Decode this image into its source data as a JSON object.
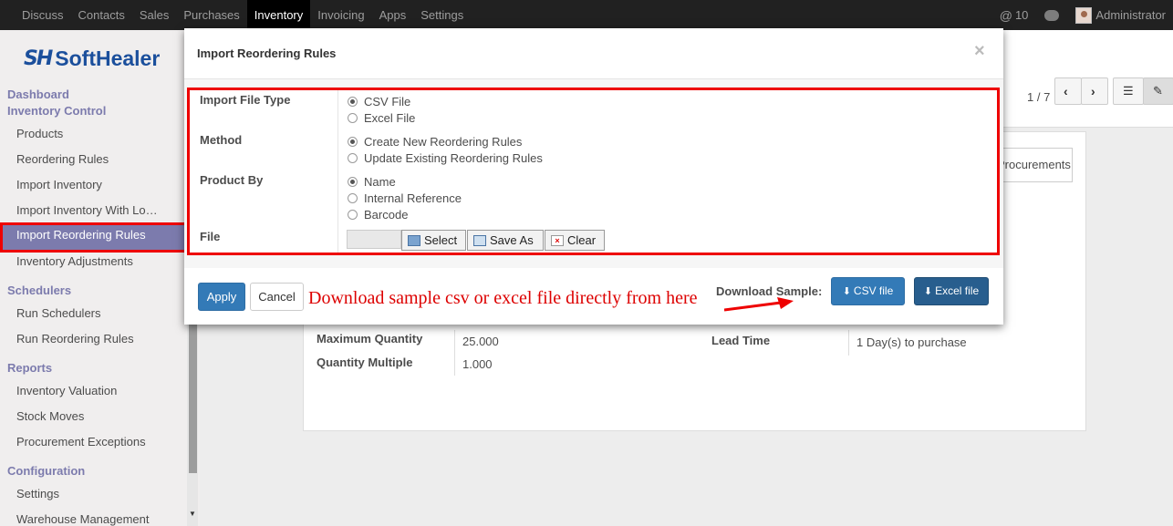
{
  "topnav": {
    "items": [
      "Discuss",
      "Contacts",
      "Sales",
      "Purchases",
      "Inventory",
      "Invoicing",
      "Apps",
      "Settings"
    ],
    "active": "Inventory",
    "message_count": "10",
    "user": "Administrator"
  },
  "logo": {
    "mark": "SH",
    "name": "SoftHealer"
  },
  "sidebar": {
    "dashboard": "Dashboard",
    "inventory_control": "Inventory Control",
    "items_control": [
      "Products",
      "Reordering Rules",
      "Import Inventory",
      "Import Inventory With Lo…",
      "Import Reordering Rules",
      "Inventory Adjustments"
    ],
    "schedulers": "Schedulers",
    "items_schedulers": [
      "Run Schedulers",
      "Run Reordering Rules"
    ],
    "reports": "Reports",
    "items_reports": [
      "Inventory Valuation",
      "Stock Moves",
      "Procurement Exceptions"
    ],
    "configuration": "Configuration",
    "items_configuration": [
      "Settings",
      "Warehouse Management"
    ]
  },
  "background": {
    "pager": "1 / 7",
    "procurements_button": "Procurements",
    "max_qty_label": "Maximum Quantity",
    "max_qty_value": "25.000",
    "qty_multiple_label": "Quantity Multiple",
    "qty_multiple_value": "1.000",
    "lead_time_label": "Lead Time",
    "lead_time_value": "1 Day(s) to purchase"
  },
  "modal": {
    "title": "Import Reordering Rules",
    "close": "×",
    "file_type": {
      "label": "Import File Type",
      "options": [
        "CSV File",
        "Excel File"
      ],
      "selected": 0
    },
    "method": {
      "label": "Method",
      "options": [
        "Create New Reordering Rules",
        "Update Existing Reordering Rules"
      ],
      "selected": 0
    },
    "product_by": {
      "label": "Product By",
      "options": [
        "Name",
        "Internal Reference",
        "Barcode"
      ],
      "selected": 0
    },
    "file": {
      "label": "File",
      "select": "Select",
      "save_as": "Save As",
      "clear": "Clear"
    },
    "apply": "Apply",
    "cancel": "Cancel",
    "annotation": "Download sample csv or excel file directly from here",
    "download_label": "Download Sample:",
    "csv_button": "CSV file",
    "excel_button": "Excel file"
  },
  "colors": {
    "accent": "#7c7bad",
    "primary": "#337ab7",
    "highlight": "#ee0000",
    "dark_button": "#285e8e"
  }
}
